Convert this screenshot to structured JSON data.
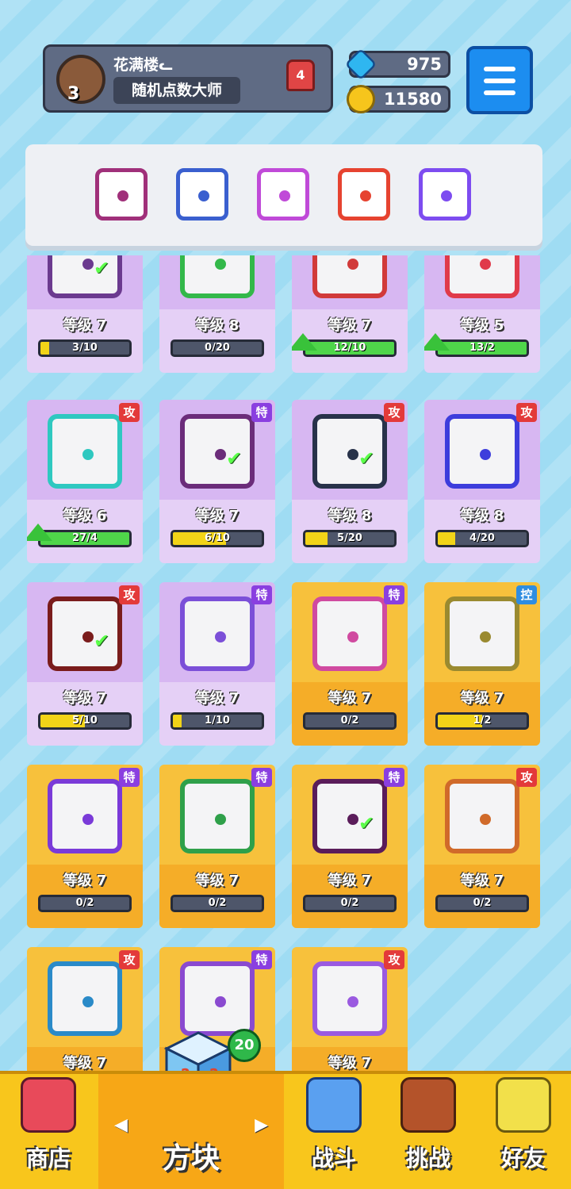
{
  "profile": {
    "name": "花满楼ᓚ",
    "title": "随机点数大师",
    "level": "3",
    "rank": "4"
  },
  "currency": {
    "gems": "975",
    "gold": "11580"
  },
  "deck": [
    {
      "icon": "dragon-sword-dice-icon",
      "color": "#a0307a"
    },
    {
      "icon": "gear-dice-icon",
      "color": "#3a5fcf"
    },
    {
      "icon": "arrow-dice-icon",
      "color": "#c04ad8"
    },
    {
      "icon": "fire-dice-icon",
      "color": "#e64330"
    },
    {
      "icon": "rainbow-dice-icon",
      "color": "#7d4cf0"
    }
  ],
  "cards": [
    {
      "level": "等级 7",
      "progress": "3/10",
      "fill": 0.1,
      "rarity": "purple",
      "tag": "",
      "arrow": false,
      "check": true,
      "color": "#6b3a8f",
      "icon": "mixed-dice-icon"
    },
    {
      "level": "等级 8",
      "progress": "0/20",
      "fill": 0,
      "rarity": "purple",
      "tag": "",
      "arrow": false,
      "check": false,
      "color": "#33b84a",
      "icon": "leaf-dice-icon"
    },
    {
      "level": "等级 7",
      "progress": "12/10",
      "fill": 1,
      "rarity": "purple",
      "tag": "",
      "arrow": true,
      "check": false,
      "color": "#d13a3a",
      "icon": "lightning-dice-icon"
    },
    {
      "level": "等级 5",
      "progress": "13/2",
      "fill": 1,
      "rarity": "purple",
      "tag": "",
      "arrow": true,
      "check": false,
      "color": "#e03a4a",
      "icon": "crit-dice-icon"
    },
    {
      "level": "等级 6",
      "progress": "27/4",
      "fill": 1,
      "rarity": "purple",
      "tag": "攻",
      "arrow": true,
      "check": false,
      "color": "#2fc8c0",
      "icon": "wind-dice-icon"
    },
    {
      "level": "等级 7",
      "progress": "6/10",
      "fill": 0.6,
      "rarity": "purple",
      "tag": "特",
      "arrow": false,
      "check": true,
      "color": "#6b2c7a",
      "icon": "arrow-dice-icon"
    },
    {
      "level": "等级 8",
      "progress": "5/20",
      "fill": 0.25,
      "rarity": "purple",
      "tag": "攻",
      "arrow": false,
      "check": true,
      "color": "#28324a",
      "icon": "gear-dice-icon"
    },
    {
      "level": "等级 8",
      "progress": "4/20",
      "fill": 0.2,
      "rarity": "purple",
      "tag": "攻",
      "arrow": false,
      "check": false,
      "color": "#3d3ddc",
      "icon": "iron-dice-icon"
    },
    {
      "level": "等级 7",
      "progress": "5/10",
      "fill": 0.5,
      "rarity": "purple",
      "tag": "攻",
      "arrow": false,
      "check": true,
      "color": "#7a1c1c",
      "icon": "fire-dice-icon"
    },
    {
      "level": "等级 7",
      "progress": "1/10",
      "fill": 0.1,
      "rarity": "purple",
      "tag": "特",
      "arrow": false,
      "check": false,
      "color": "#7b4fd8",
      "icon": "electric-dice-icon"
    },
    {
      "level": "等级 7",
      "progress": "0/2",
      "fill": 0,
      "rarity": "gold",
      "tag": "特",
      "arrow": false,
      "check": false,
      "color": "#d04aa0",
      "icon": "infinity-dice-icon"
    },
    {
      "level": "等级 7",
      "progress": "1/2",
      "fill": 0.5,
      "rarity": "gold",
      "tag": "控",
      "arrow": false,
      "check": false,
      "color": "#9a8a30",
      "icon": "shield-dice-icon"
    },
    {
      "level": "等级 7",
      "progress": "0/2",
      "fill": 0,
      "rarity": "gold",
      "tag": "特",
      "arrow": false,
      "check": false,
      "color": "#7a3ad8",
      "icon": "arrow-up-dice-icon"
    },
    {
      "level": "等级 7",
      "progress": "0/2",
      "fill": 0,
      "rarity": "gold",
      "tag": "特",
      "arrow": false,
      "check": false,
      "color": "#2fa04a",
      "icon": "pentagram-dice-icon"
    },
    {
      "level": "等级 7",
      "progress": "0/2",
      "fill": 0,
      "rarity": "gold",
      "tag": "特",
      "arrow": false,
      "check": true,
      "color": "#5a1c5a",
      "icon": "sword-dice-icon"
    },
    {
      "level": "等级 7",
      "progress": "0/2",
      "fill": 0,
      "rarity": "gold",
      "tag": "攻",
      "arrow": false,
      "check": false,
      "color": "#d06a2a",
      "icon": "gun-dice-icon"
    },
    {
      "level": "等级 7",
      "progress": "",
      "fill": 0,
      "rarity": "gold",
      "tag": "攻",
      "arrow": false,
      "check": false,
      "color": "#2a8ac8",
      "icon": "vortex-dice-icon"
    },
    {
      "level": "",
      "progress": "",
      "fill": 0,
      "rarity": "gold",
      "tag": "特",
      "arrow": false,
      "check": false,
      "color": "#8a4ad0",
      "icon": "gravity-dice-icon"
    },
    {
      "level": "等级 7",
      "progress": "",
      "fill": 0,
      "rarity": "gold",
      "tag": "攻",
      "arrow": false,
      "check": false,
      "color": "#9a5ae0",
      "icon": "star-dice-icon"
    }
  ],
  "nav": {
    "shop": "商店",
    "dice": "方块",
    "battle": "战斗",
    "challenge": "挑战",
    "friends": "好友",
    "dice_badge": "20",
    "prev": "◀",
    "next": "▶"
  }
}
